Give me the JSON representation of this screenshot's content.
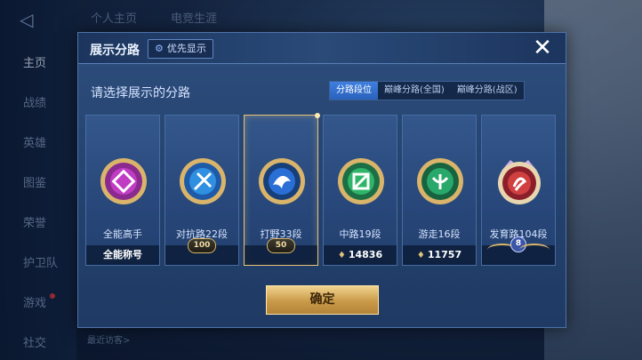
{
  "background": {
    "sidebar": [
      {
        "label": "主页",
        "active": true
      },
      {
        "label": "战绩"
      },
      {
        "label": "英雄"
      },
      {
        "label": "图鉴"
      },
      {
        "label": "荣誉"
      },
      {
        "label": "护卫队"
      },
      {
        "label": "游戏"
      },
      {
        "label": "社交"
      }
    ],
    "tabs": [
      "个人主页",
      "电竞生涯"
    ],
    "bottom_hint": "最近访客>"
  },
  "modal": {
    "title": "展示分路",
    "priority_chip": "优先显示",
    "close_icon": "close-icon",
    "prompt": "请选择展示的分路",
    "segments": [
      {
        "label": "分路段位",
        "active": true
      },
      {
        "label": "巅峰分路(全国)",
        "active": false
      },
      {
        "label": "巅峰分路(战区)",
        "active": false
      }
    ],
    "cards": [
      {
        "name": "全能高手",
        "footer": "全能称号",
        "emblem": "all-round-emblem-icon",
        "color": "#c03cc4",
        "selected": false
      },
      {
        "name": "对抗路22段",
        "footer": "",
        "badge": "100",
        "emblem": "clash-lane-emblem-icon",
        "color": "#2f8fe0",
        "selected": false
      },
      {
        "name": "打野33段",
        "footer": "",
        "badge": "50",
        "emblem": "jungle-emblem-icon",
        "color": "#2a6fd6",
        "selected": true
      },
      {
        "name": "中路19段",
        "footer": "14836",
        "emblem": "mid-lane-emblem-icon",
        "color": "#2fb56a",
        "selected": false
      },
      {
        "name": "游走16段",
        "footer": "11757",
        "emblem": "roam-emblem-icon",
        "color": "#28a86a",
        "selected": false
      },
      {
        "name": "发育路104段",
        "footer": "",
        "badge": "8",
        "emblem": "farm-lane-emblem-icon",
        "color": "#d04040",
        "selected": false
      }
    ],
    "confirm_label": "确定"
  }
}
